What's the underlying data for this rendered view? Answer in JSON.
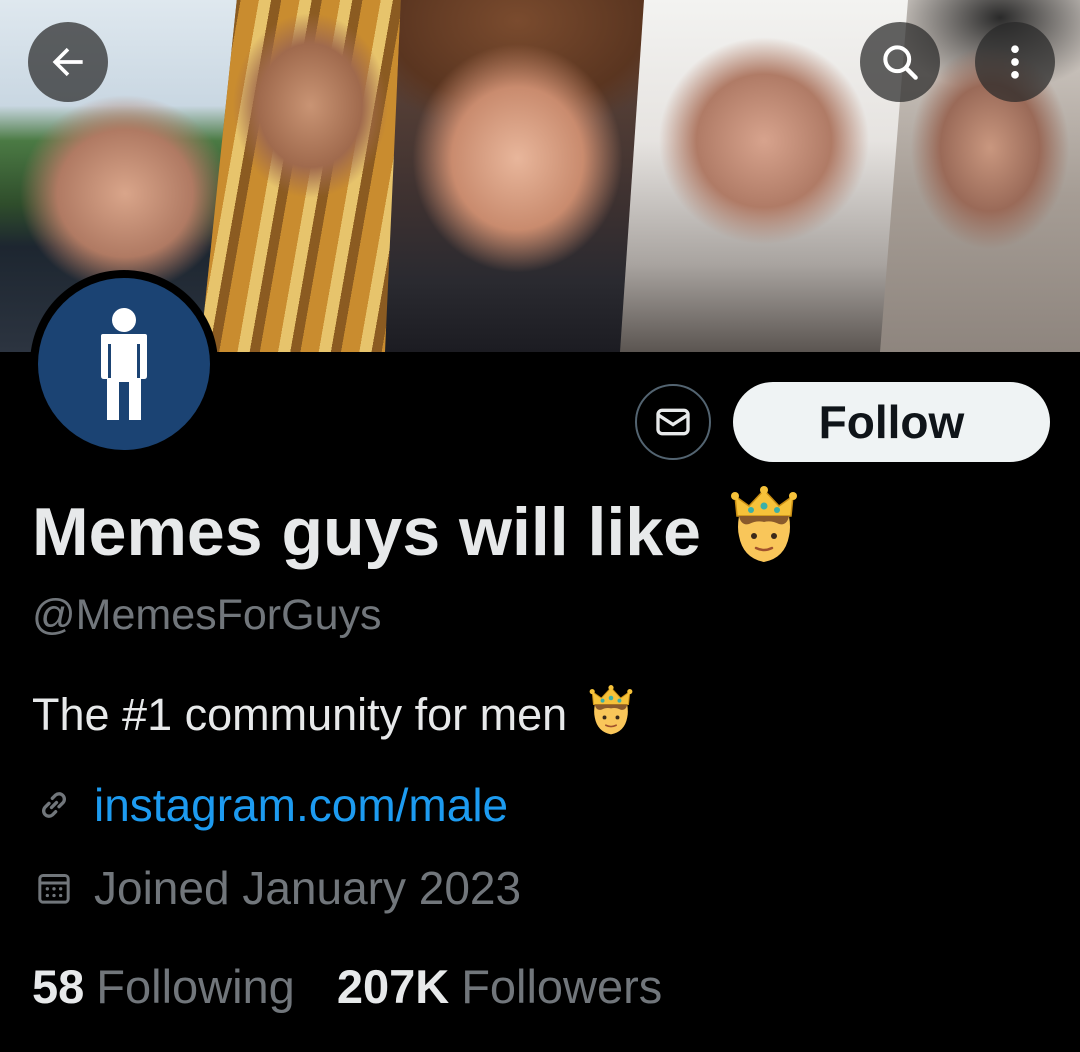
{
  "banner": {
    "alt_image_description": ""
  },
  "top_bar": {
    "back_icon": "arrow-left-icon",
    "search_icon": "search-icon",
    "more_icon": "more-vertical-icon"
  },
  "profile": {
    "display_name": "Memes guys will like",
    "display_name_emoji": "👨‍👑",
    "handle": "@MemesForGuys",
    "bio": "The #1 community for men",
    "bio_emoji": "👨‍👑",
    "link": "instagram.com/male",
    "joined": "Joined January 2023",
    "avatar_icon": "person-icon"
  },
  "actions": {
    "message_icon": "envelope-icon",
    "follow_label": "Follow"
  },
  "stats": {
    "following_count": "58",
    "following_label": "Following",
    "followers_count": "207K",
    "followers_label": "Followers"
  },
  "colors": {
    "background": "#000000",
    "primary_text": "#e7e9ea",
    "secondary_text": "#71767b",
    "link": "#1d9bf0",
    "avatar_bg": "#1b4373",
    "follow_bg": "#eff3f4"
  }
}
